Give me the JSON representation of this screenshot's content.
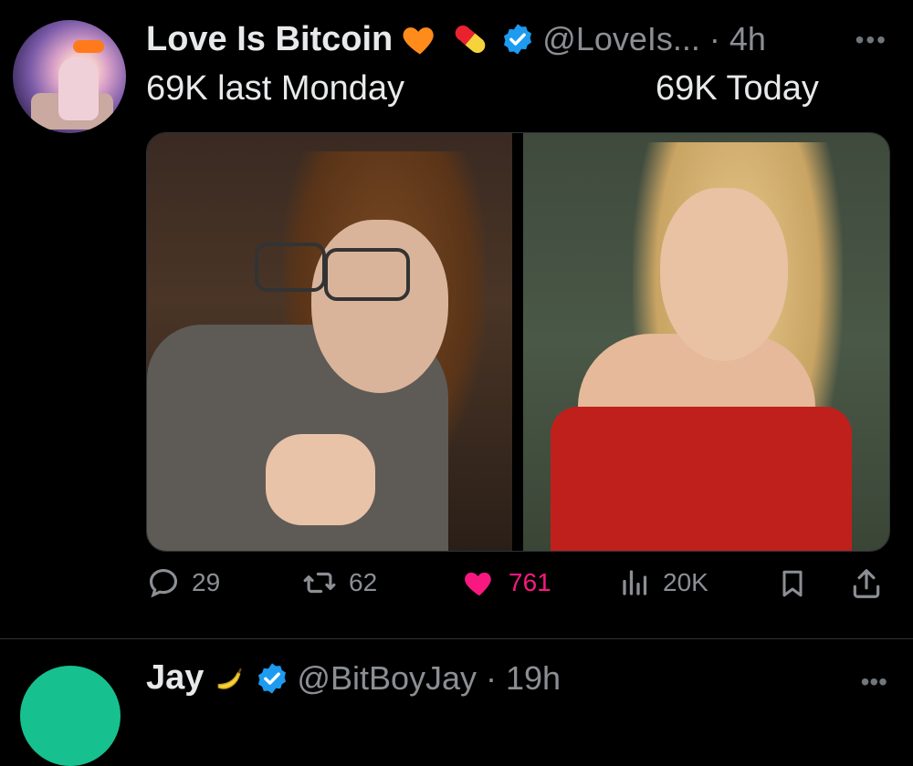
{
  "tweet": {
    "display_name": "Love Is Bitcoin",
    "handle_time": "@LoveIs... · 4h",
    "more": "•••",
    "text_left": "69K last Monday",
    "text_right": "69K Today",
    "emojis": [
      "orange-heart",
      "pill"
    ],
    "verified": true,
    "actions": {
      "replies": "29",
      "retweets": "62",
      "likes": "761",
      "views": "20K"
    },
    "like_color": "#f91880",
    "verified_color": "#1d9bf0"
  },
  "next_tweet": {
    "display_name": "Jay",
    "emoji": "banana",
    "handle_time": "@BitBoyJay · 19h",
    "more": "•••"
  }
}
